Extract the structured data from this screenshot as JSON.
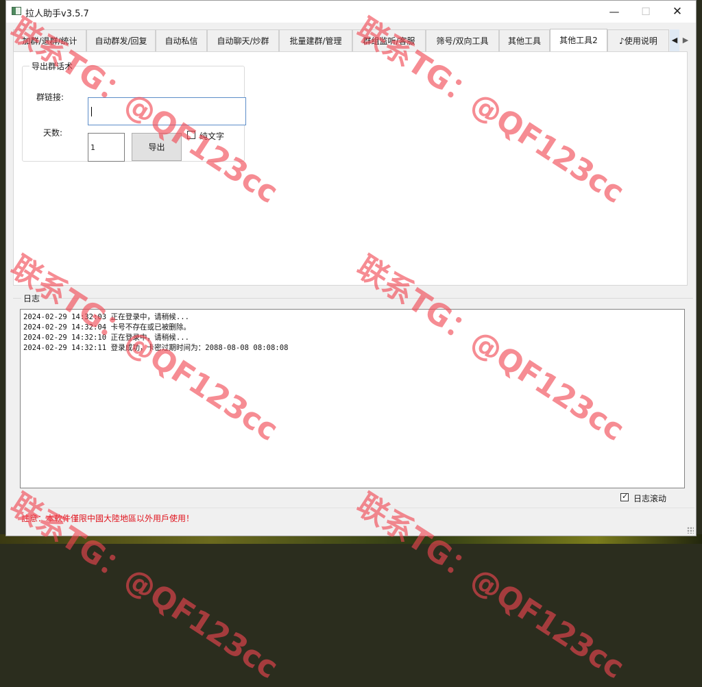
{
  "window": {
    "title": "拉人助手v3.5.7",
    "minimize_glyph": "—",
    "maximize_glyph": "☐",
    "close_glyph": "✕"
  },
  "tabs": [
    {
      "label": "加群/退群/统计",
      "active": false
    },
    {
      "label": "自动群发/回复",
      "active": false
    },
    {
      "label": "自动私信",
      "active": false
    },
    {
      "label": "自动聊天/炒群",
      "active": false
    },
    {
      "label": "批量建群/管理",
      "active": false
    },
    {
      "label": "群组监听/客服",
      "active": false
    },
    {
      "label": "筛号/双向工具",
      "active": false
    },
    {
      "label": "其他工具",
      "active": false
    },
    {
      "label": "其他工具2",
      "active": true
    },
    {
      "label": "♪使用说明",
      "active": false
    }
  ],
  "tab_scroll": {
    "left_glyph": "◀",
    "right_glyph": "▶"
  },
  "export_group": {
    "title": "导出群话术",
    "group_link_label": "群链接:",
    "group_link_value": "",
    "days_label": "天数:",
    "days_value": "1",
    "export_button": "导出",
    "plain_text_label": "纯文字",
    "plain_text_checked": false
  },
  "log": {
    "title": "日志",
    "lines": [
      "2024-02-29 14:32:03 正在登录中，请稍候...",
      "2024-02-29 14:32:04 卡号不存在或已被删除。",
      "2024-02-29 14:32:10 正在登录中，请稍候...",
      "2024-02-29 14:32:11 登录成功，卡密过期时间为：2088-08-08 08:08:08"
    ],
    "auto_scroll_label": "日志滚动",
    "auto_scroll_checked": true
  },
  "notice": "註意：本軟件僅限中國大陸地區以外用戶使用！",
  "watermark": "联系TG：@QF123cc",
  "colors": {
    "notice": "#e0141e",
    "watermark": "#f04650",
    "input_focus": "#5b8cc8"
  }
}
